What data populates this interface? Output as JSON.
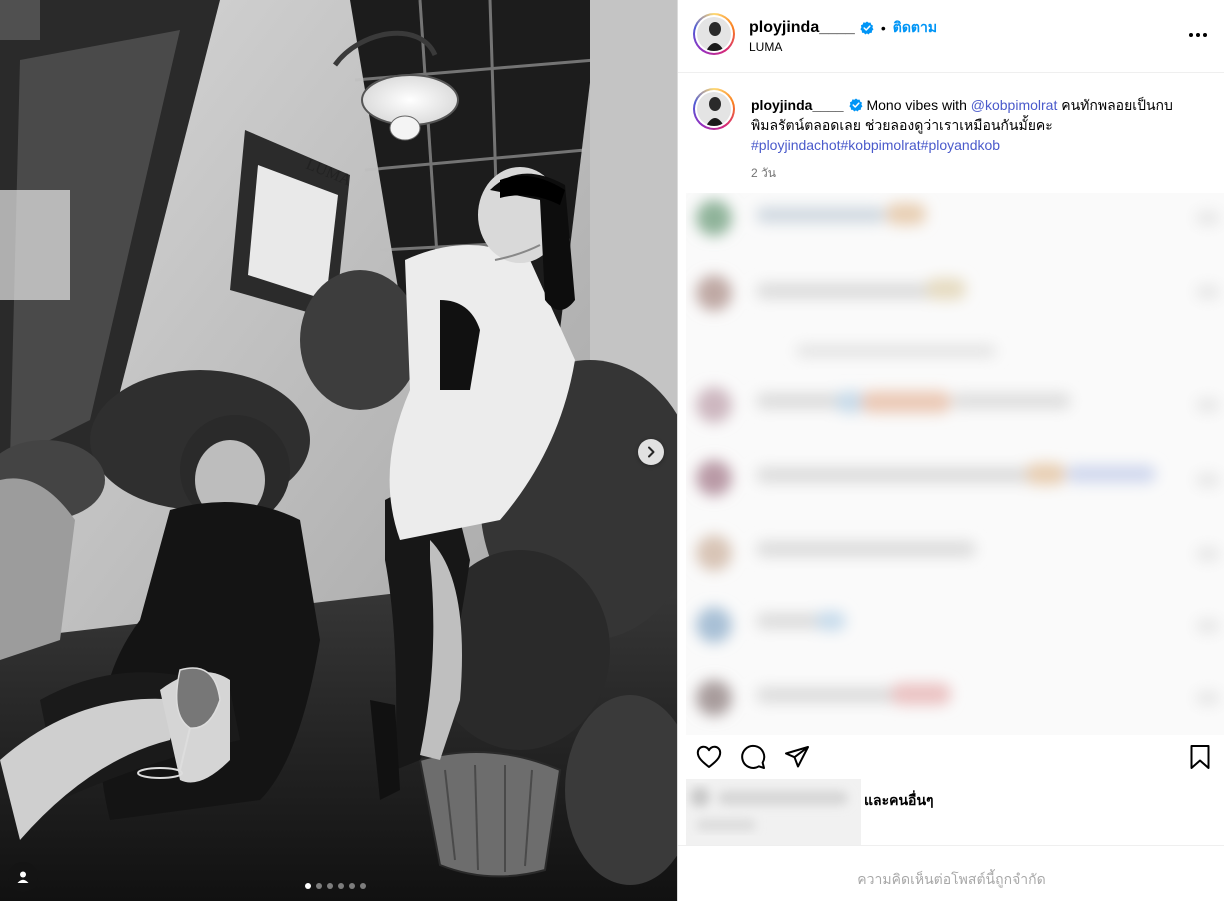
{
  "post": {
    "username": "ployjinda____",
    "location": "LUMA",
    "follow_label": "ติดตาม",
    "separator": "•",
    "sign_text": "LUMA",
    "carousel": {
      "slide_count": 6,
      "active_index": 0
    }
  },
  "caption": {
    "username": "ployjinda____",
    "text_before": " Mono vibes with ",
    "mention": "@kobpimolrat",
    "text_after": " คนทักพลอยเป็นกบ พิมลรัตน์ตลอดเลย ช่วยลองดูว่าเราเหมือนกันมั้ยคะ",
    "hashtags": [
      "#ployjindachot",
      "#kobpimolrat",
      "#ployandkob"
    ],
    "time": "2 วัน"
  },
  "likes": {
    "suffix": "และคนอื่นๆ"
  },
  "comments_restricted": "ความคิดเห็นต่อโพสต์นี้ถูกจำกัด",
  "colors": {
    "accent": "#0095f6",
    "link": "#4a5acb",
    "muted": "#737373",
    "restricted": "#a8a8a8"
  },
  "icons": [
    "chevron-right-icon",
    "user-tag-icon",
    "verified-badge-icon",
    "more-options-icon",
    "heart-icon",
    "comment-icon",
    "share-icon",
    "bookmark-icon"
  ]
}
